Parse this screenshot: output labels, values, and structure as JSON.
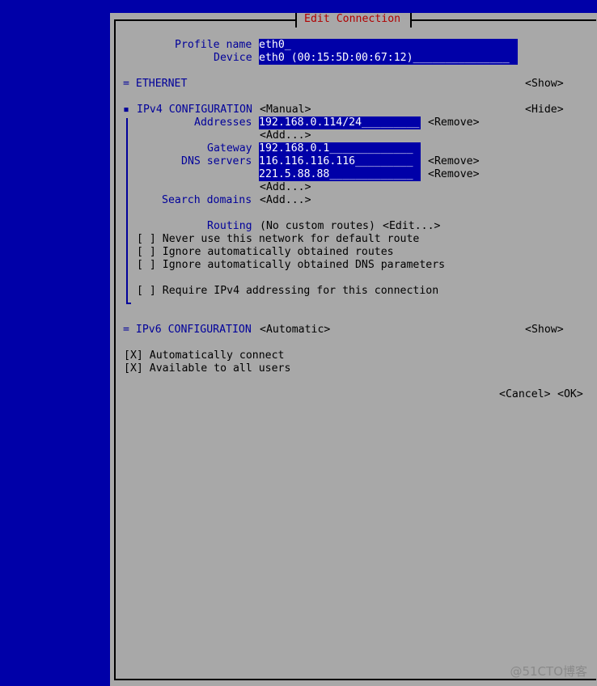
{
  "dialog": {
    "title": "Edit Connection"
  },
  "profile": {
    "label": "Profile name",
    "value": "eth0_",
    "device_label": "Device",
    "device_value": "eth0 (00:15:5D:00:67:12)_______________"
  },
  "ethernet": {
    "label": "= ETHERNET",
    "toggle": "<Show>"
  },
  "ipv4": {
    "bullet": "▪",
    "label": "IPv4 CONFIGURATION",
    "method": "<Manual>",
    "toggle": "<Hide>",
    "addresses_label": "Addresses",
    "addresses": [
      {
        "value": "192.168.0.114/24_________",
        "remove": "<Remove>"
      }
    ],
    "add_address": "<Add...>",
    "gateway_label": "Gateway",
    "gateway_value": "192.168.0.1_____________",
    "dns_label": "DNS servers",
    "dns": [
      {
        "value": "116.116.116.116_________",
        "remove": "<Remove>"
      },
      {
        "value": "221.5.88.88_____________",
        "remove": "<Remove>"
      }
    ],
    "add_dns": "<Add...>",
    "search_label": "Search domains",
    "add_search": "<Add...>",
    "routing_label": "Routing",
    "routing_value": "(No custom routes)",
    "routing_edit": "<Edit...>",
    "checks": [
      "[ ] Never use this network for default route",
      "[ ] Ignore automatically obtained routes",
      "[ ] Ignore automatically obtained DNS parameters"
    ],
    "require_check": "[ ] Require IPv4 addressing for this connection"
  },
  "ipv6": {
    "label": "= IPv6 CONFIGURATION",
    "method": "<Automatic>",
    "toggle": "<Show>"
  },
  "options": {
    "auto_connect": "[X] Automatically connect",
    "all_users": "[X] Available to all users"
  },
  "buttons": {
    "cancel": "<Cancel>",
    "ok": "<OK>"
  },
  "watermark": "@51CTO博客",
  "colors": {
    "background": "#0000a8",
    "panel": "#a8a8a8",
    "label": "#00009a",
    "title": "#b00000",
    "field": "#0000a8"
  }
}
